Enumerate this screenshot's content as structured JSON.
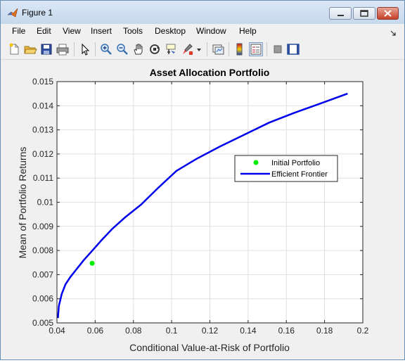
{
  "window": {
    "title": "Figure 1"
  },
  "menu": {
    "items": [
      "File",
      "Edit",
      "View",
      "Insert",
      "Tools",
      "Desktop",
      "Window",
      "Help"
    ]
  },
  "toolbar": {
    "icons": [
      "new-file-icon",
      "open-folder-icon",
      "save-icon",
      "print-icon",
      "pointer-icon",
      "zoom-in-icon",
      "zoom-out-icon",
      "pan-icon",
      "rotate-3d-icon",
      "data-cursor-icon",
      "brush-icon",
      "link-plot-icon",
      "colorbar-icon",
      "legend-icon",
      "hide-plot-tools-icon",
      "show-plot-tools-icon"
    ]
  },
  "colors": {
    "frontier": "#0000ee",
    "initial_portfolio": "#00ee00",
    "plot_background": "#ffffff",
    "figure_background": "#f0f0f0"
  },
  "chart_data": {
    "type": "line",
    "title": "Asset Allocation Portfolio",
    "xlabel": "Conditional Value-at-Risk of Portfolio",
    "ylabel": "Mean of Portfolio Returns",
    "xlim": [
      0.04,
      0.2
    ],
    "ylim": [
      0.005,
      0.015
    ],
    "xticks": [
      "0.04",
      "0.06",
      "0.08",
      "0.1",
      "0.12",
      "0.14",
      "0.16",
      "0.18",
      "0.2"
    ],
    "yticks": [
      "0.005",
      "0.006",
      "0.007",
      "0.008",
      "0.009",
      "0.01",
      "0.011",
      "0.012",
      "0.013",
      "0.014",
      "0.015"
    ],
    "grid": true,
    "legend_position": "center-right",
    "series": [
      {
        "name": "Initial Portfolio",
        "kind": "marker",
        "x": [
          0.0584
        ],
        "y": [
          0.00747
        ]
      },
      {
        "name": "Efficient Frontier",
        "kind": "line",
        "x": [
          0.0405,
          0.041,
          0.0425,
          0.0445,
          0.047,
          0.05,
          0.054,
          0.058,
          0.063,
          0.069,
          0.076,
          0.084,
          0.093,
          0.1025,
          0.113,
          0.125,
          0.138,
          0.151,
          0.164,
          0.178,
          0.192
        ],
        "y": [
          0.0052,
          0.0057,
          0.0062,
          0.0066,
          0.0069,
          0.0072,
          0.0076,
          0.00795,
          0.0084,
          0.0089,
          0.0094,
          0.0099,
          0.0106,
          0.0113,
          0.0118,
          0.0123,
          0.0128,
          0.0133,
          0.0137,
          0.0141,
          0.0145
        ]
      }
    ]
  }
}
